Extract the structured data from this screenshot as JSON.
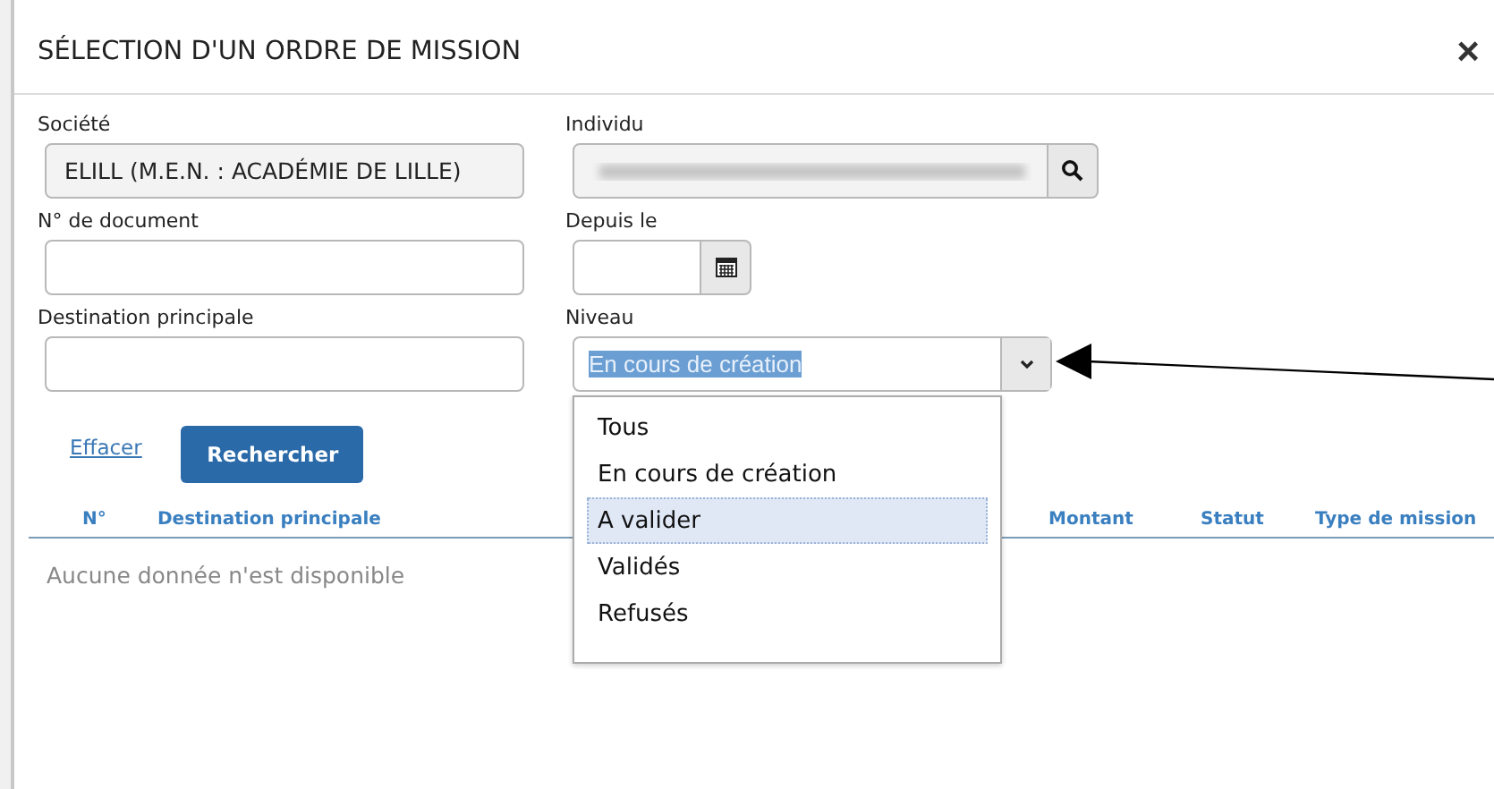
{
  "dialog": {
    "title": "SÉLECTION D'UN ORDRE DE MISSION",
    "close": "×"
  },
  "form": {
    "societe": {
      "label": "Société",
      "value": "ELILL (M.E.N. : ACADÉMIE DE LILLE)"
    },
    "individu": {
      "label": "Individu"
    },
    "document": {
      "label": "N° de document"
    },
    "depuis": {
      "label": "Depuis le"
    },
    "destination": {
      "label": "Destination principale"
    },
    "niveau": {
      "label": "Niveau",
      "value": "En cours de création",
      "expanded": true,
      "options": [
        {
          "label": "Tous",
          "highlighted": false
        },
        {
          "label": "En cours de création",
          "highlighted": false
        },
        {
          "label": "A valider",
          "highlighted": true
        },
        {
          "label": "Validés",
          "highlighted": false
        },
        {
          "label": "Refusés",
          "highlighted": false
        }
      ]
    }
  },
  "actions": {
    "clear": "Effacer",
    "search": "Rechercher"
  },
  "table": {
    "columns": [
      "N°",
      "Destination principale",
      "Montant",
      "Statut",
      "Type de mission"
    ],
    "empty": "Aucune donnée n'est disponible"
  }
}
